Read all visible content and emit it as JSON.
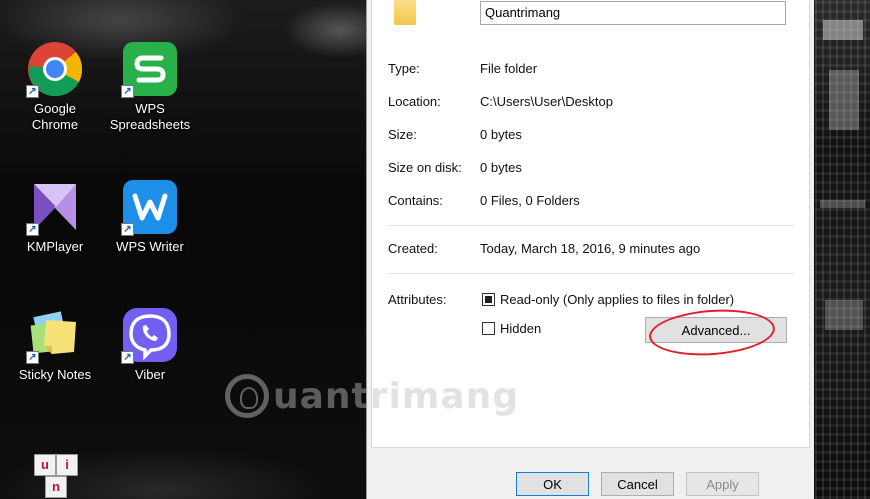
{
  "desktop": {
    "icons": [
      {
        "label": "Google\nChrome",
        "icon": "chrome-icon"
      },
      {
        "label": "WPS\nSpreadsheets",
        "icon": "wps-spreadsheets-icon"
      },
      {
        "label": "KMPlayer",
        "icon": "kmplayer-icon"
      },
      {
        "label": "WPS Writer",
        "icon": "wps-writer-icon"
      },
      {
        "label": "Sticky Notes",
        "icon": "sticky-notes-icon"
      },
      {
        "label": "Viber",
        "icon": "viber-icon"
      },
      {
        "label": "",
        "icon": "unikey-icon",
        "tile_letters": [
          "u",
          "i",
          "n"
        ]
      }
    ]
  },
  "properties": {
    "folder_name": "Quantrimang",
    "rows": [
      {
        "label": "Type:",
        "value": "File folder"
      },
      {
        "label": "Location:",
        "value": "C:\\Users\\User\\Desktop"
      },
      {
        "label": "Size:",
        "value": "0 bytes"
      },
      {
        "label": "Size on disk:",
        "value": "0 bytes"
      },
      {
        "label": "Contains:",
        "value": "0 Files, 0 Folders"
      }
    ],
    "created": {
      "label": "Created:",
      "value": "Today, March 18, 2016, 9 minutes ago"
    },
    "attributes": {
      "label": "Attributes:",
      "readonly": {
        "text": "Read-only (Only applies to files in folder)",
        "state": "indeterminate"
      },
      "hidden": {
        "text": "Hidden",
        "state": "unchecked"
      },
      "advanced_button": "Advanced..."
    },
    "buttons": {
      "ok": "OK",
      "cancel": "Cancel",
      "apply": "Apply"
    }
  },
  "watermark": {
    "text": "uantrimang"
  },
  "colors": {
    "highlight_ellipse": "#e0202a",
    "dialog_bg": "#f0f0f0"
  }
}
